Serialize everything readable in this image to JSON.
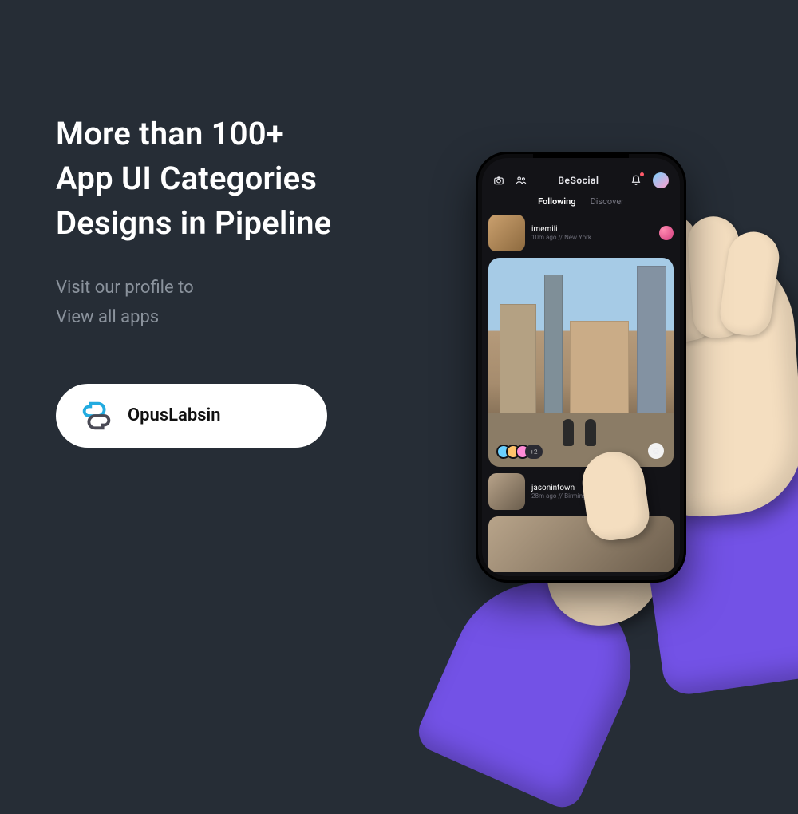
{
  "promo": {
    "headline_l1": "More than 100+",
    "headline_l2": "App UI Categories",
    "headline_l3": "Designs in Pipeline",
    "sub_l1": "Visit our profile to",
    "sub_l2": "View all apps",
    "brand_name": "OpusLabsin"
  },
  "app": {
    "title": "BeSocial",
    "tabs": {
      "following": "Following",
      "discover": "Discover"
    },
    "post1": {
      "username": "imemili",
      "meta": "10m ago // New York",
      "plus_label": "+2"
    },
    "post2": {
      "username": "jasonintown",
      "meta": "28m ago // Birmingham"
    }
  }
}
